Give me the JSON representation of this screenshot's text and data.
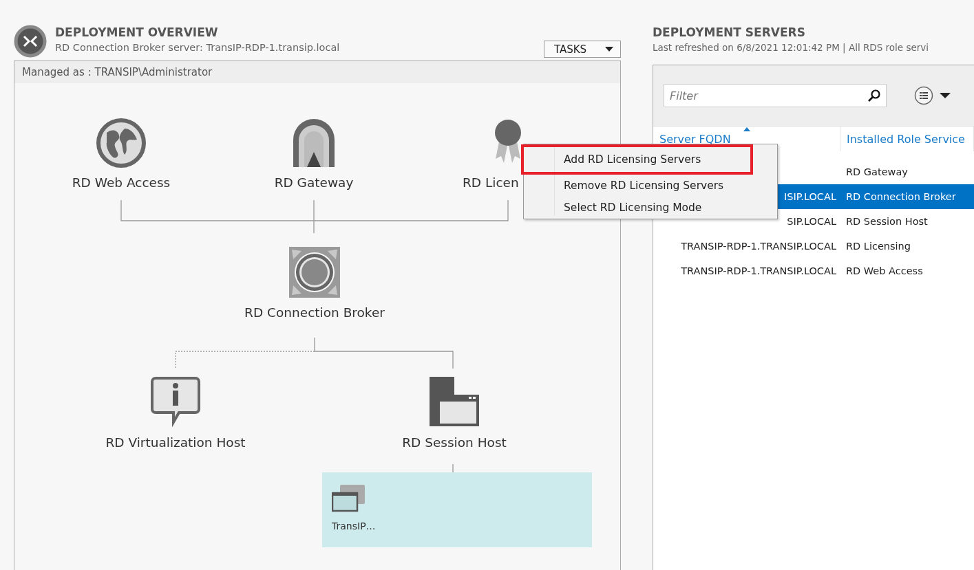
{
  "overview": {
    "title": "DEPLOYMENT OVERVIEW",
    "subtitle": "RD Connection Broker server: TransIP-RDP-1.transip.local",
    "tasks_button": "TASKS",
    "managed_as": "Managed as : TRANSIP\\Administrator",
    "nodes": [
      {
        "kind": "web",
        "label": "RD Web Access"
      },
      {
        "kind": "gateway",
        "label": "RD Gateway"
      },
      {
        "kind": "licensing",
        "label": "RD Licen"
      },
      {
        "kind": "broker",
        "label": "RD Connection Broker"
      },
      {
        "kind": "virtualization",
        "label": "RD Virtualization Host"
      },
      {
        "kind": "session",
        "label": "RD Session Host"
      }
    ],
    "collection": {
      "label": "TransIP…"
    },
    "context_menu": [
      {
        "label": "Add RD Licensing Servers",
        "highlighted": true
      },
      {
        "label": "Remove RD Licensing Servers",
        "highlighted": false
      },
      {
        "label": "Select RD Licensing Mode",
        "highlighted": false
      }
    ]
  },
  "servers": {
    "title": "DEPLOYMENT SERVERS",
    "subtitle": "Last refreshed on 6/8/2021 12:01:42 PM | All RDS role servi",
    "filter": {
      "placeholder": "Filter"
    },
    "columns": [
      {
        "label": "Server FQDN",
        "sorted": true
      },
      {
        "label": "Installed Role Service",
        "sorted": false
      }
    ],
    "rows": [
      {
        "role": "RD Gateway",
        "selected": false
      },
      {
        "fqdn": "ISIP.LOCAL",
        "role": "RD Connection Broker",
        "selected": true
      },
      {
        "fqdn": "SIP.LOCAL",
        "role": "RD Session Host",
        "selected": false
      },
      {
        "fqdn": "TRANSIP-RDP-1.TRANSIP.LOCAL",
        "role": "RD Licensing",
        "selected": false
      },
      {
        "fqdn": "TRANSIP-RDP-1.TRANSIP.LOCAL",
        "role": "RD Web Access",
        "selected": false
      }
    ]
  }
}
